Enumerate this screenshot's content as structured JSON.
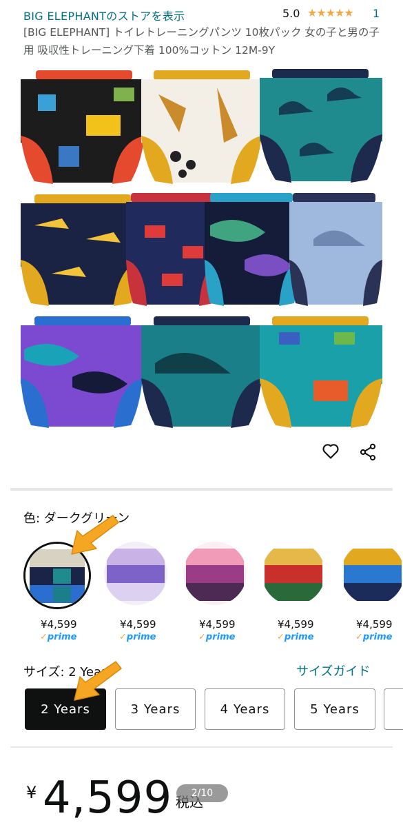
{
  "header": {
    "store_link": "BIG ELEPHANTのストアを表示",
    "rating": "5.0",
    "stars": "★★★★★",
    "rating_count": "1",
    "title": "[BIG ELEPHANT] トイレトレーニングパンツ 10枚パック 女の子と男の子用 吸収性トレーニング下着 100%コットン 12M-9Y"
  },
  "actions": {
    "favorite_icon": "heart-icon",
    "share_icon": "share-icon"
  },
  "color": {
    "label": "色: ダークグリーン",
    "options": [
      {
        "price": "¥4,599",
        "prime": "prime"
      },
      {
        "price": "¥4,599",
        "prime": "prime"
      },
      {
        "price": "¥4,599",
        "prime": "prime"
      },
      {
        "price": "¥4,599",
        "prime": "prime"
      },
      {
        "price": "¥4,599",
        "prime": "prime"
      }
    ]
  },
  "size": {
    "label": "サイズ: 2 Years",
    "guide": "サイズガイド",
    "options": [
      "2 Years",
      "3 Years",
      "4 Years",
      "5 Years"
    ]
  },
  "price": {
    "currency": "¥",
    "amount": "4,599",
    "tax": "税込"
  },
  "pager": "2/10",
  "colors": {
    "link": "#007185",
    "star": "#f3a847",
    "arrow": "#f5a623",
    "prime": "#1a98ff"
  }
}
